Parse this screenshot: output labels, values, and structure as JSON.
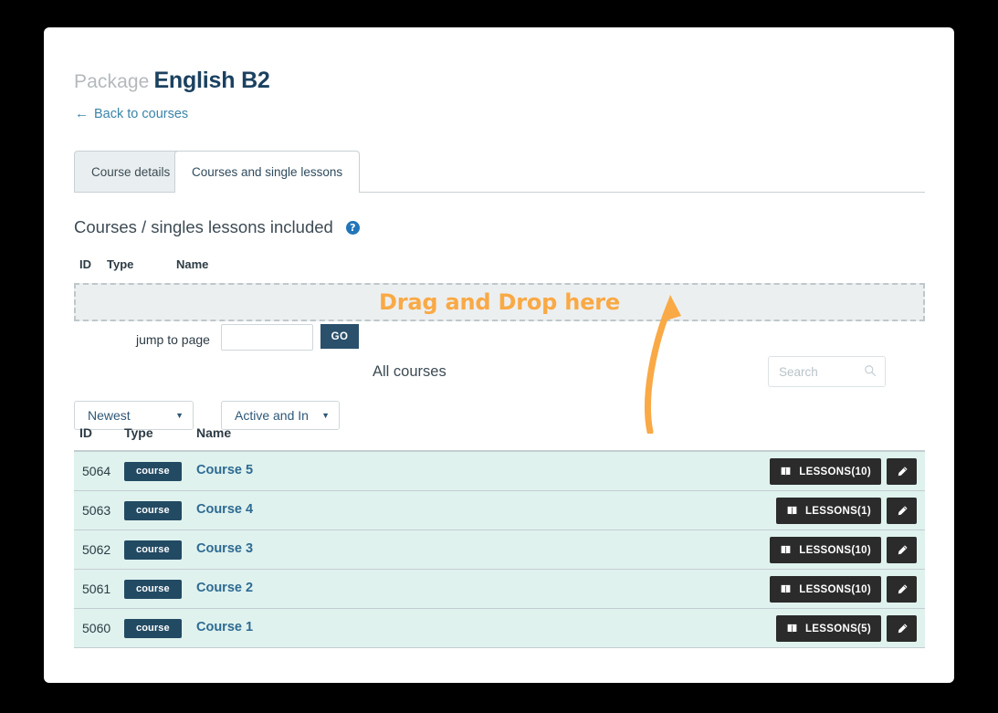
{
  "header": {
    "title_label": "Package",
    "title_value": "English B2",
    "back_link": "Back to courses",
    "back_arrow_icon": "arrow-left-icon"
  },
  "tabs": [
    {
      "label": "Course details",
      "active": false
    },
    {
      "label": "Courses and single lessons",
      "active": true
    }
  ],
  "included_section": {
    "heading": "Courses / singles lessons included",
    "help_icon": "help-circle-icon",
    "help_icon_glyph": "?",
    "columns": {
      "id": "ID",
      "type": "Type",
      "name": "Name"
    },
    "dropzone_text": "Drag and Drop here",
    "dropzone_color": "#f9a945",
    "rows": []
  },
  "pagination": {
    "jump_label": "jump to page",
    "jump_value": "",
    "go_label": "GO"
  },
  "all_courses": {
    "heading": "All courses",
    "sort_select": {
      "value": "Newest",
      "caret_icon": "chevron-down-icon"
    },
    "status_select": {
      "value": "Active and In",
      "caret_icon": "chevron-down-icon"
    },
    "search": {
      "placeholder": "Search",
      "value": "",
      "icon": "search-icon"
    },
    "columns": {
      "id": "ID",
      "type": "Type",
      "name": "Name"
    },
    "rows": [
      {
        "id": "5064",
        "type": "course",
        "name": "Course 5",
        "lessons_label": "LESSONS(10)",
        "lessons_icon": "book-icon",
        "edit_icon": "pencil-icon"
      },
      {
        "id": "5063",
        "type": "course",
        "name": "Course 4",
        "lessons_label": "LESSONS(1)",
        "lessons_icon": "book-icon",
        "edit_icon": "pencil-icon"
      },
      {
        "id": "5062",
        "type": "course",
        "name": "Course 3",
        "lessons_label": "LESSONS(10)",
        "lessons_icon": "book-icon",
        "edit_icon": "pencil-icon"
      },
      {
        "id": "5061",
        "type": "course",
        "name": "Course 2",
        "lessons_label": "LESSONS(10)",
        "lessons_icon": "book-icon",
        "edit_icon": "pencil-icon"
      },
      {
        "id": "5060",
        "type": "course",
        "name": "Course 1",
        "lessons_label": "LESSONS(5)",
        "lessons_icon": "book-icon",
        "edit_icon": "pencil-icon"
      }
    ]
  },
  "annotation": {
    "arrow_icon": "curved-arrow-up-icon",
    "color": "#f9a945"
  },
  "colors": {
    "accent_orange": "#f9a945",
    "dark_navy": "#234a63",
    "row_mint": "#dff2ee",
    "link_blue": "#2e6a92",
    "page_background": "#000000",
    "card_background": "#ffffff"
  }
}
